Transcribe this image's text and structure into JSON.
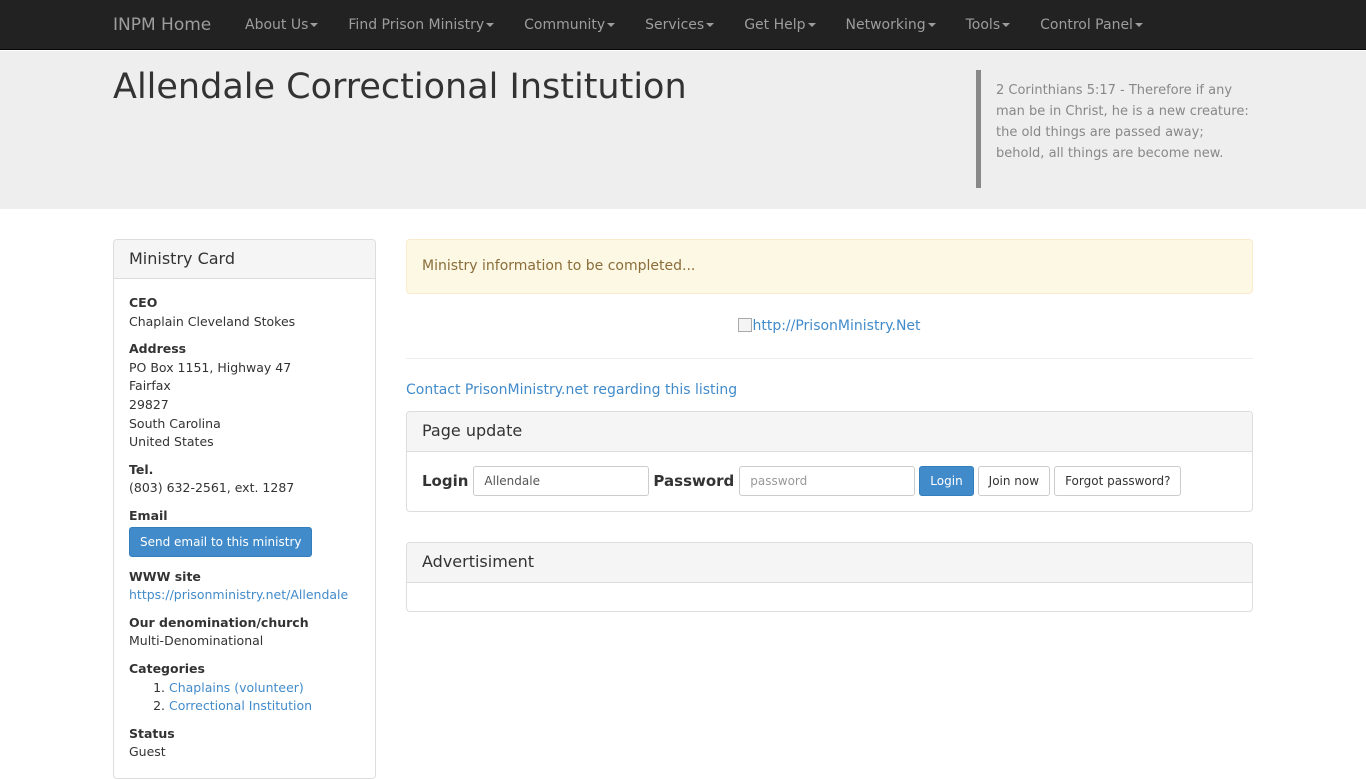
{
  "navbar": {
    "brand": "INPM Home",
    "items": [
      {
        "label": "About Us"
      },
      {
        "label": "Find Prison Ministry"
      },
      {
        "label": "Community"
      },
      {
        "label": "Services"
      },
      {
        "label": "Get Help"
      },
      {
        "label": "Networking"
      },
      {
        "label": "Tools"
      },
      {
        "label": "Control Panel"
      }
    ]
  },
  "header": {
    "title": "Allendale Correctional Institution",
    "quote": "2 Corinthians 5:17 - Therefore if any man be in Christ, he is a new creature: the old things are passed away; behold, all things are become new."
  },
  "ministry_card": {
    "heading": "Ministry Card",
    "ceo_label": "CEO",
    "ceo": "Chaplain Cleveland Stokes",
    "address_label": "Address",
    "address_lines": [
      "PO Box 1151, Highway 47",
      "Fairfax",
      "29827",
      "South Carolina",
      "United States"
    ],
    "tel_label": "Tel.",
    "tel": "(803) 632-2561, ext. 1287",
    "email_label": "Email",
    "email_button": "Send email to this ministry",
    "www_label": "WWW site",
    "www": "https://prisonministry.net/Allendale",
    "denomination_label": "Our denomination/church",
    "denomination": "Multi-Denominational",
    "categories_label": "Categories",
    "categories": [
      "Chaplains (volunteer)",
      "Correctional Institution"
    ],
    "status_label": "Status",
    "status": "Guest"
  },
  "main": {
    "alert": "Ministry information to be completed...",
    "banner_alt": "http://PrisonMinistry.Net",
    "contact_link": "Contact PrisonMinistry.net regarding this listing",
    "page_update": {
      "heading": "Page update",
      "login_label": "Login",
      "login_value": "Allendale",
      "password_label": "Password",
      "password_placeholder": "password",
      "login_button": "Login",
      "join_button": "Join now",
      "forgot_button": "Forgot password?"
    },
    "advertisement": {
      "heading": "Advertisiment"
    }
  },
  "colors": {
    "navbar_bg": "#222222",
    "nav_text": "#9d9d9d",
    "jumbotron_bg": "#eeeeee",
    "link": "#428bca",
    "alert_bg": "#fcf8e3",
    "alert_text": "#8a6d3b",
    "primary_button": "#428bca"
  }
}
